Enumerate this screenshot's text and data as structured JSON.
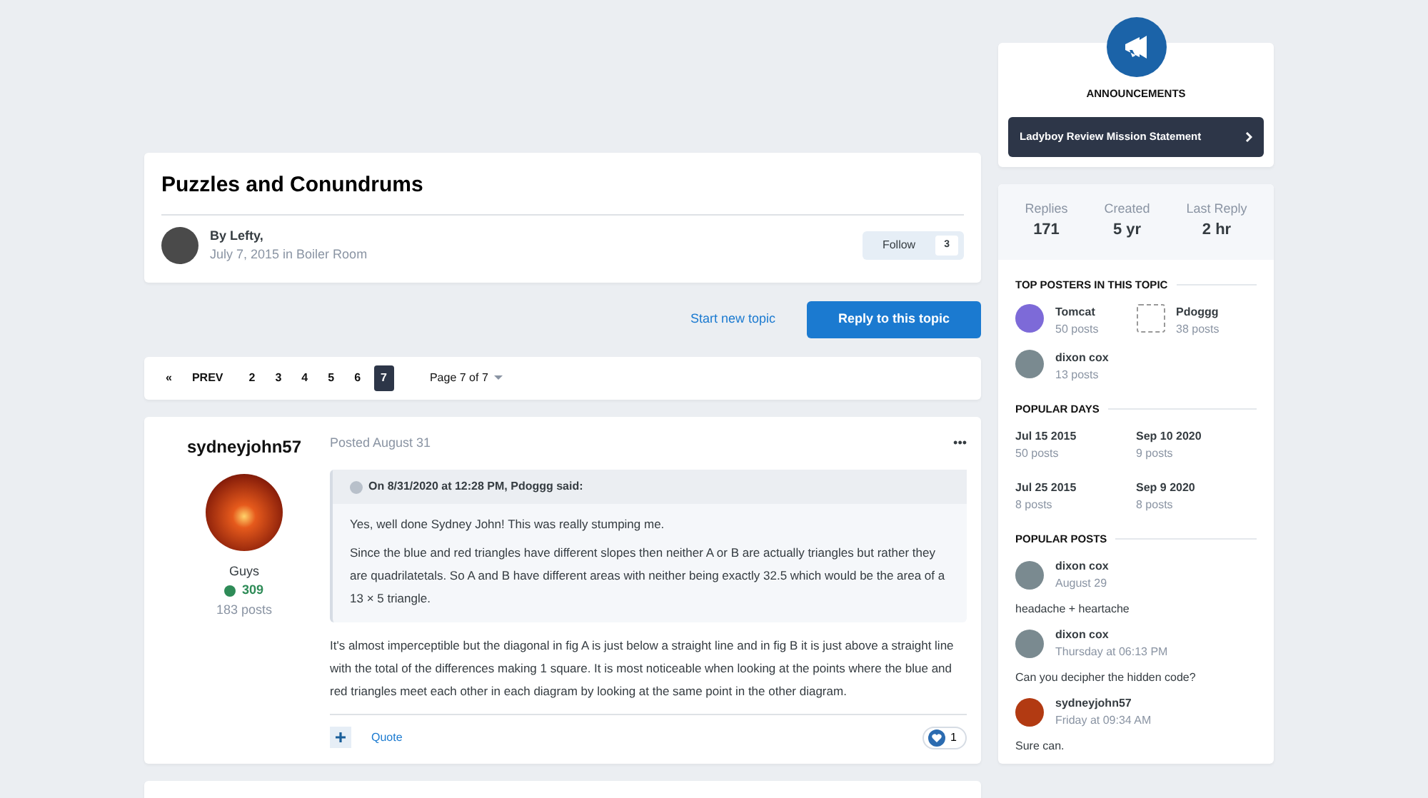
{
  "topic": {
    "title": "Puzzles and Conundrums",
    "author": "By Lefty,",
    "date": "July 7, 2015 in",
    "forum": "Boiler Room",
    "follow_label": "Follow",
    "follow_count": "3"
  },
  "actions": {
    "start_topic": "Start new topic",
    "reply": "Reply to this topic"
  },
  "pagination": {
    "first": "«",
    "prev": "PREV",
    "pages": [
      {
        "label": "2",
        "selected": false
      },
      {
        "label": "3",
        "selected": false
      },
      {
        "label": "4",
        "selected": false
      },
      {
        "label": "5",
        "selected": false
      },
      {
        "label": "6",
        "selected": false
      },
      {
        "label": "7",
        "selected": true
      }
    ],
    "page_jump": "Page 7 of 7"
  },
  "post": {
    "author": "sydneyjohn57",
    "group": "Guys",
    "reputation": "309",
    "post_count": "183 posts",
    "posted": "Posted August 31",
    "menu": "•••",
    "quote": {
      "header": "On 8/31/2020 at 12:28 PM, Pdoggg said:",
      "paragraphs": [
        "Yes, well done Sydney John!  This was really stumping me.",
        "Since the blue and red triangles have different slopes then neither A or B are actually triangles but rather they are quadrilatetals. So A and B have different areas with neither being exactly 32.5 which would be the area of a 13 × 5 triangle."
      ]
    },
    "body": "It's almost imperceptible but the diagonal in fig A is just below a straight line and in fig B it is just above a straight line with the total of the differences making 1 square. It is most noticeable when looking at the points where the blue and red triangles meet each other in each diagram by looking at the same point in the other diagram.",
    "quote_button": "Quote",
    "reaction_count": "1"
  },
  "sidebar": {
    "announcements": {
      "title": "ANNOUNCEMENTS",
      "items": [
        "Ladyboy Review Mission Statement"
      ]
    },
    "stats": [
      {
        "label": "Replies",
        "value": "171"
      },
      {
        "label": "Created",
        "value": "5 yr"
      },
      {
        "label": "Last Reply",
        "value": "2 hr"
      }
    ],
    "top_posters_title": "TOP POSTERS IN THIS TOPIC",
    "top_posters": [
      {
        "name": "Tomcat",
        "posts": "50 posts"
      },
      {
        "name": "Pdoggg",
        "posts": "38 posts"
      },
      {
        "name": "dixon cox",
        "posts": "13 posts"
      }
    ],
    "popular_days_title": "POPULAR DAYS",
    "popular_days": [
      {
        "date": "Jul 15 2015",
        "posts": "50 posts"
      },
      {
        "date": "Sep 10 2020",
        "posts": "9 posts"
      },
      {
        "date": "Jul 25 2015",
        "posts": "8 posts"
      },
      {
        "date": "Sep 9 2020",
        "posts": "8 posts"
      }
    ],
    "popular_posts_title": "POPULAR POSTS",
    "popular_posts": [
      {
        "name": "dixon cox",
        "time": "August 29",
        "excerpt": "headache + heartache"
      },
      {
        "name": "dixon cox",
        "time": "Thursday at 06:13 PM",
        "excerpt": "Can you decipher the hidden code?"
      },
      {
        "name": "sydneyjohn57",
        "time": "Friday at 09:34 AM",
        "excerpt": "Sure can."
      }
    ]
  }
}
